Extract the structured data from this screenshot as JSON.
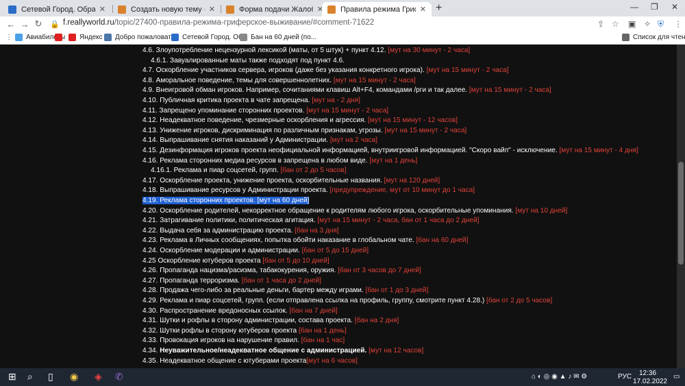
{
  "tabs": [
    {
      "title": "Сетевой Город. Образование. Д",
      "favicon_color": "#2a6cc8",
      "active": false
    },
    {
      "title": "Создать новую тему - ReallyWo",
      "favicon_color": "#d9822b",
      "active": false
    },
    {
      "title": "Форма подачи Жалобы на Адм",
      "favicon_color": "#d9822b",
      "active": false
    },
    {
      "title": "Правила режима Гриферское в",
      "favicon_color": "#d9822b",
      "active": true
    }
  ],
  "window_controls": {
    "minimize": "—",
    "restore": "❐",
    "close": "✕"
  },
  "address": {
    "host": "f.reallyworld.ru",
    "path": "/topic/27400-правила-режима-гриферское-выживание/#comment-71622"
  },
  "bookmarks": [
    {
      "label": "Авиабилеты",
      "color": "#4aa0e6"
    },
    {
      "label": "",
      "color": "#e02020"
    },
    {
      "label": "Яндекс",
      "color": "#e02020"
    },
    {
      "label": "Добро пожаловат...",
      "color": "#4a76a8"
    },
    {
      "label": "Сетевой Город. Об...",
      "color": "#2a6cc8"
    },
    {
      "label": "Бан на 60 дней (по...",
      "color": "#888888"
    }
  ],
  "reading_list": "Список для чтения",
  "rules": [
    {
      "text": "4.6. Злоупотребление нецензурной лексикой (маты, от 5 штук) + пункт 4.12. ",
      "penalty": "[мут на 30 минут - 2 часа]"
    },
    {
      "text": "4.6.1. Завуалированные маты также подходят под пункт 4.6.",
      "penalty": "",
      "indent": true
    },
    {
      "text": "4.7. Оскорбление участников сервера, игроков (даже без указания конкретного игрока). ",
      "penalty": "[мут на 15 минут - 2 часа]"
    },
    {
      "text": "4.8. Аморальное поведение, темы для совершеннолетних. ",
      "penalty": "[мут на 15 минут - 2 часа]"
    },
    {
      "text": "4.9. Внеигровой обман игроков. Например, сочитаниями клавиш Alt+F4, командами /рги и так далее. ",
      "penalty": "[мут на 15 минут - 2 часа]"
    },
    {
      "text": "4.10. Публичная критика проекта в чате запрещена. ",
      "penalty": "[мут на - 2 дня]"
    },
    {
      "text": "4.11. Запрещено упоминание сторонних проектов. ",
      "penalty": "[мут на 15 минут - 2 часа]"
    },
    {
      "text": "4.12. Неадекватное поведение, чрезмерные оскорбления и агрессия. ",
      "penalty": "[мут на 15 минут - 12 часов]"
    },
    {
      "text": "4.13. Унижение игроков, дискриминация по различным признакам, угрозы. ",
      "penalty": "[мут на 15 минут - 2 часа]"
    },
    {
      "text": "4.14. Выпрашивание снятия наказаний у Администрации. ",
      "penalty": "[мут на 2 часа]"
    },
    {
      "text": "4.15. Дезинформация игроков проекта неофициальной информацией, внутриигровой информацией. \"Скоро вайп\" - исключение. ",
      "penalty": "[мут на 15 минут - 4 дня]"
    },
    {
      "text": "4.16. Реклама сторонних медиа ресурсов в запрещена в любом виде. ",
      "penalty": "[мут на 1 день]"
    },
    {
      "text": "4.16.1. Реклама и пиар соцсетей, групп. ",
      "penalty": "[бан от 2 до 5 часов]",
      "indent": true
    },
    {
      "text": "4.17. Оскорбление проекта, унижение проекта, оскорбительные названия. ",
      "penalty": "[мут на 120 дней]"
    },
    {
      "text": "4.18. Выпрашивание ресурсов у Администрации проекта. ",
      "penalty": "[предупреждение, мут от 10 минут до 1 часа]"
    },
    {
      "text": "4.19. Реклама сторонних проектов. ",
      "penalty": "[мут на 60 дней]",
      "highlight": true
    },
    {
      "text": "4.20. Оскорбление родителей, некорректное обращение к родителям любого игрока, оскорбительные упоминания. ",
      "penalty": "[мут на 10 дней]"
    },
    {
      "text": "4.21. Затрагивание политики, политическая агитация. ",
      "penalty": "[мут на 15 минут - 2 часа, бан от 1 часа до 2 дней]"
    },
    {
      "text": "4.22. Выдача себя за администрацию проекта. ",
      "penalty": "[бан на 3 дня]"
    },
    {
      "text": "4.23. Реклама в Личных сообщениях, попытка обойти наказание в глобальном чате. ",
      "penalty": "[бан на 60 дней]"
    },
    {
      "text": "4.24. Оскорбление модерации и администрации. ",
      "penalty": "[бан от 5 до 15 дней]"
    },
    {
      "text": "4.25 Оскорбление ютуберов проекта ",
      "penalty": "[бан от 5 до 10 дней]"
    },
    {
      "text": "4.26. Пропаганда нацизма/расизма, табакокурения, оружия. ",
      "penalty": "[бан от 3 часов до 7 дней]"
    },
    {
      "text": "4.27. Пропаганда терроризма. ",
      "penalty": "[бан от 1 часа до 2 дней]"
    },
    {
      "text": "4.28. Продажа чего-либо за реальные деньги, бартер между играми. ",
      "penalty": "[бан от 1 до 3 дней]"
    },
    {
      "text": "4.29. Реклама и пиар соцсетей, групп. (если отправлена ссылка на профиль, группу, смотрите пункт 4.28.) ",
      "penalty": "[бан от 2 до 5 часов]"
    },
    {
      "text": "4.30. Распространение вредоносных ссылок. ",
      "penalty": "[бан на 7 дней]"
    },
    {
      "text": "4.31. Шутки и рофлы в сторону администрации, состава проекта. ",
      "penalty": "[бан на 2 дня]"
    },
    {
      "text": "4.32. Шутки рофлы в сторону ютуберов проекта ",
      "penalty": "[бан на 1 день]"
    },
    {
      "text": "4.33. Провокация игроков на нарушение правил. ",
      "penalty": "[бан на 1 час]"
    },
    {
      "text": "4.34. ",
      "bold": "Неуважительное/неадекватное общение с администрацией.",
      "penalty": "[мут на 12 часов]"
    },
    {
      "text": "4.35. Неадекватное общение с ютуберами проекта",
      "penalty": "[мут на 6 часов]"
    }
  ],
  "taskbar": {
    "lang": "РУС",
    "time": "12:36",
    "date": "17.02.2022"
  }
}
